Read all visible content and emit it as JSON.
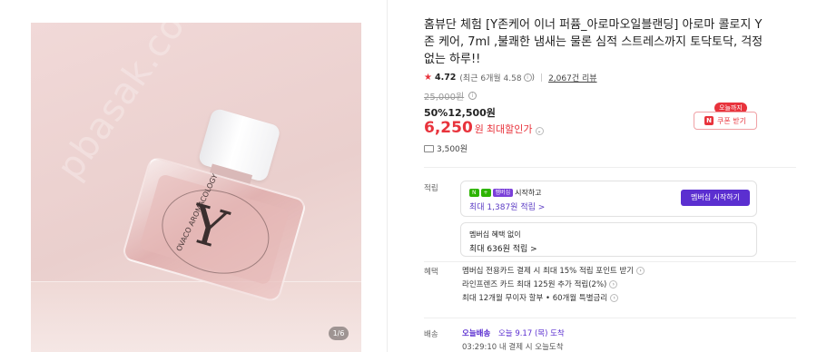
{
  "gallery": {
    "watermark": "pbasak.com",
    "counter": "1/6",
    "bottle_letter": "Y",
    "bottle_text": "OVACO AROMACOLOGY",
    "colors": {
      "background": "#eacfcd",
      "glass": "#dfadac",
      "cap": "#ffffff"
    }
  },
  "product": {
    "title": "홈뷰단 체험 [Y존케어 이너 퍼퓸_아로마오일블랜딩] 아로마 콜로지 Y존 케어, 7ml ,불쾌한 냄새는 물론 심적 스트레스까지 토닥토닥, 걱정 없는 하루!!"
  },
  "rating": {
    "score": "4.72",
    "recent": "(최근 6개월 4.58",
    "recent_close": ")",
    "reviews": "2,067건 리뷰",
    "star_color": "#e8333c"
  },
  "price": {
    "original": "25,000원",
    "sale": "50%12,500원",
    "max_discount_value": "6,250",
    "max_discount_unit": "원",
    "max_discount_label": "최대할인가",
    "accent": "#e8333c"
  },
  "coupon": {
    "badge": "오늘까지",
    "icon": "N",
    "label": "쿠폰 받기"
  },
  "shipping_fee": "3,500원",
  "points": {
    "label": "적립",
    "card1": {
      "badge_n": "N",
      "badge_plus": "+",
      "badge_member": "멤버십",
      "line1": "시작하고",
      "line2": "최대 1,387원 적립 >",
      "button": "멤버십 시작하기",
      "button_color": "#5b2fd0"
    },
    "card2": {
      "line1": "멤버십 혜택 없이",
      "line2": "최대 636원 적립 >"
    }
  },
  "benefits": {
    "label": "혜택",
    "items": [
      "멤버십 전용카드 결제 시 최대 15% 적립 포인트 받기",
      "라인프렌즈 카드 최대 125원 추가 적립(2%)",
      "최대 12개월 무이자 할부 • 60개월 특별금리"
    ]
  },
  "delivery": {
    "label": "배송",
    "badge": "오늘배송",
    "arrive": "오늘 9.17 (목) 도착",
    "cutoff": "03:29:10 내 결제 시 오늘도착"
  }
}
